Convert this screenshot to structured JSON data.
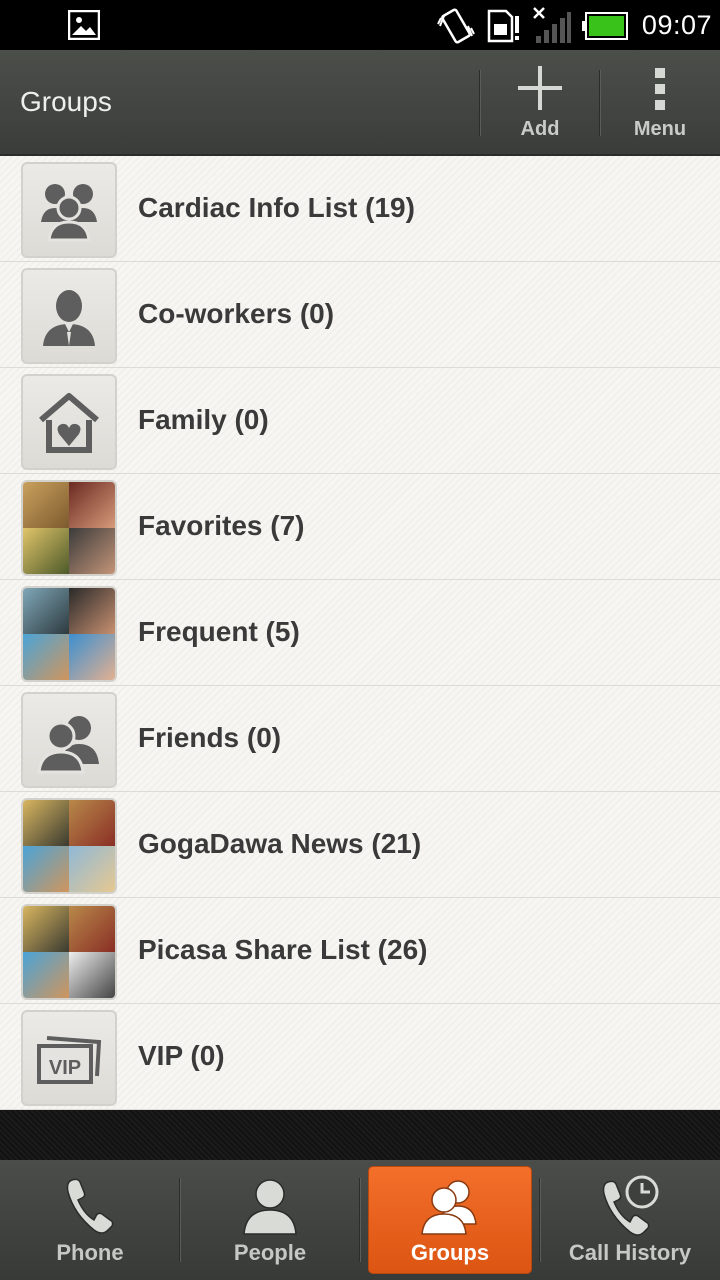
{
  "status_bar": {
    "time": "09:07",
    "icons": [
      "gallery-notification-icon",
      "vibrate-icon",
      "sim-warning-icon",
      "no-signal-icon",
      "battery-icon"
    ],
    "battery_color": "#39c21a"
  },
  "action_bar": {
    "title": "Groups",
    "add_label": "Add",
    "menu_label": "Menu"
  },
  "groups": [
    {
      "label": "Cardiac Info List (19)",
      "icon": "group-people-icon"
    },
    {
      "label": "Co-workers (0)",
      "icon": "coworker-icon"
    },
    {
      "label": "Family (0)",
      "icon": "family-home-icon"
    },
    {
      "label": "Favorites (7)",
      "icon": "photo-mosaic"
    },
    {
      "label": "Frequent (5)",
      "icon": "photo-mosaic"
    },
    {
      "label": "Friends (0)",
      "icon": "friends-icon"
    },
    {
      "label": "GogaDawa News (21)",
      "icon": "photo-mosaic"
    },
    {
      "label": "Picasa Share List (26)",
      "icon": "photo-mosaic"
    },
    {
      "label": "VIP (0)",
      "icon": "vip-icon"
    }
  ],
  "tabs": [
    {
      "label": "Phone",
      "icon": "phone-icon",
      "active": false
    },
    {
      "label": "People",
      "icon": "person-icon",
      "active": false
    },
    {
      "label": "Groups",
      "icon": "groups-icon",
      "active": true
    },
    {
      "label": "Call History",
      "icon": "call-history-icon",
      "active": false
    }
  ],
  "colors": {
    "accent": "#e8621d",
    "action_bar": "#424540",
    "list_bg": "#f5f4f0",
    "text": "#3a3a3a"
  }
}
